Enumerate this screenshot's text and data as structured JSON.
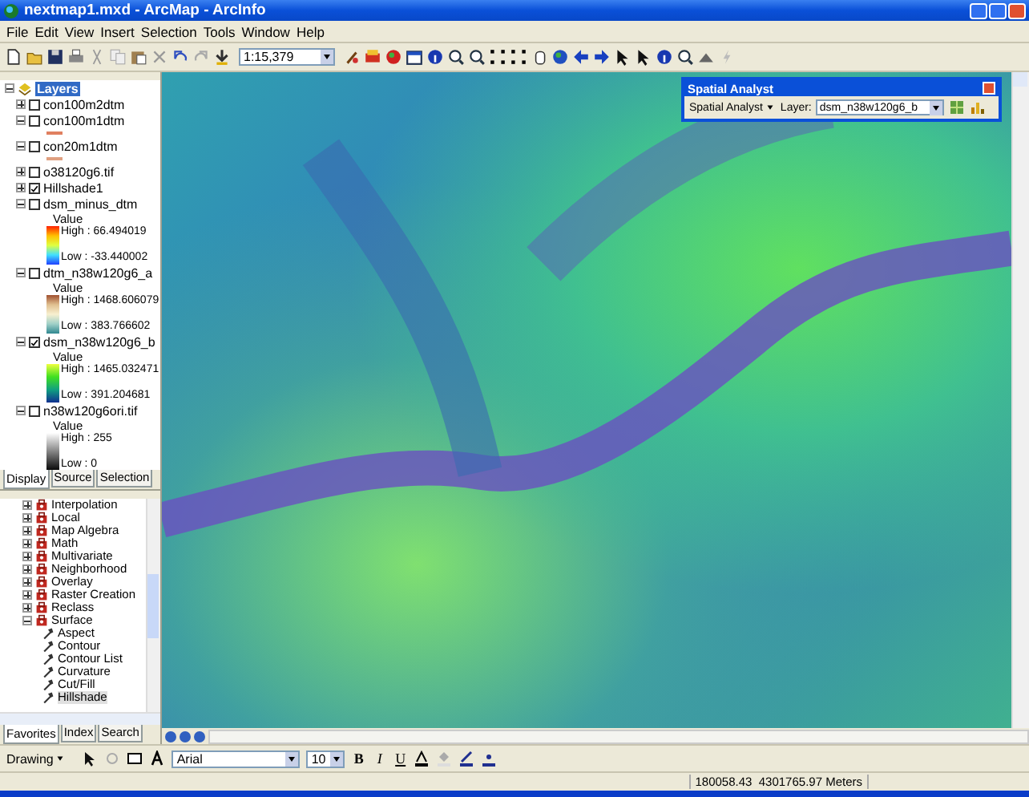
{
  "window": {
    "title": "nextmap1.mxd - ArcMap - ArcInfo"
  },
  "menu": [
    "File",
    "Edit",
    "View",
    "Insert",
    "Selection",
    "Tools",
    "Window",
    "Help"
  ],
  "toolbar": {
    "scale": "1:15,379"
  },
  "toc": {
    "root": "Layers",
    "layers": [
      {
        "name": "con100m2dtm",
        "checked": false,
        "expanded": false
      },
      {
        "name": "con100m1dtm",
        "checked": false,
        "expanded": true,
        "legend": {
          "kind": "line",
          "color": "#e08060"
        }
      },
      {
        "name": "con20m1dtm",
        "checked": false,
        "expanded": true,
        "legend": {
          "kind": "line",
          "color": "#e0a080"
        }
      },
      {
        "name": "o38120g6.tif",
        "checked": false,
        "expanded": false
      },
      {
        "name": "Hillshade1",
        "checked": true,
        "expanded": false
      },
      {
        "name": "dsm_minus_dtm",
        "checked": false,
        "expanded": true,
        "legend": {
          "kind": "ramp",
          "field": "Value",
          "high": "High : 66.494019",
          "low": "Low : -33.440002"
        }
      },
      {
        "name": "dtm_n38w120g6_a",
        "checked": false,
        "expanded": true,
        "legend": {
          "kind": "ramp",
          "field": "Value",
          "high": "High : 1468.606079",
          "low": "Low : 383.766602"
        }
      },
      {
        "name": "dsm_n38w120g6_b",
        "checked": true,
        "expanded": true,
        "legend": {
          "kind": "ramp",
          "field": "Value",
          "high": "High : 1465.032471",
          "low": "Low : 391.204681"
        }
      },
      {
        "name": "n38w120g6ori.tif",
        "checked": false,
        "expanded": true,
        "legend": {
          "kind": "ramp",
          "field": "Value",
          "high": "High : 255",
          "low": "Low : 0"
        }
      }
    ],
    "tabs": [
      {
        "label": "Display",
        "selected": true
      },
      {
        "label": "Source",
        "selected": false
      },
      {
        "label": "Selection",
        "selected": false
      }
    ]
  },
  "toolbox": {
    "items": [
      {
        "label": "Interpolation",
        "expanded": false
      },
      {
        "label": "Local",
        "expanded": false
      },
      {
        "label": "Map Algebra",
        "expanded": false
      },
      {
        "label": "Math",
        "expanded": false
      },
      {
        "label": "Multivariate",
        "expanded": false
      },
      {
        "label": "Neighborhood",
        "expanded": false
      },
      {
        "label": "Overlay",
        "expanded": false
      },
      {
        "label": "Raster Creation",
        "expanded": false
      },
      {
        "label": "Reclass",
        "expanded": false
      },
      {
        "label": "Surface",
        "expanded": true,
        "children": [
          {
            "label": "Aspect",
            "selected": false
          },
          {
            "label": "Contour",
            "selected": false
          },
          {
            "label": "Contour List",
            "selected": false
          },
          {
            "label": "Curvature",
            "selected": false
          },
          {
            "label": "Cut/Fill",
            "selected": false
          },
          {
            "label": "Hillshade",
            "selected": true
          }
        ]
      }
    ],
    "tabs": [
      {
        "label": "Favorites",
        "selected": true
      },
      {
        "label": "Index",
        "selected": false
      },
      {
        "label": "Search",
        "selected": false
      }
    ]
  },
  "spatial_analyst": {
    "title": "Spatial Analyst",
    "menu": "Spatial Analyst",
    "layer_label": "Layer:",
    "layer": "dsm_n38w120g6_b"
  },
  "drawing": {
    "menu": "Drawing",
    "font": "Arial",
    "size": "10",
    "bold": "B",
    "italic": "I",
    "underline": "U"
  },
  "status_bar": {
    "coordinates": "180058.43  4301765.97 Meters"
  }
}
